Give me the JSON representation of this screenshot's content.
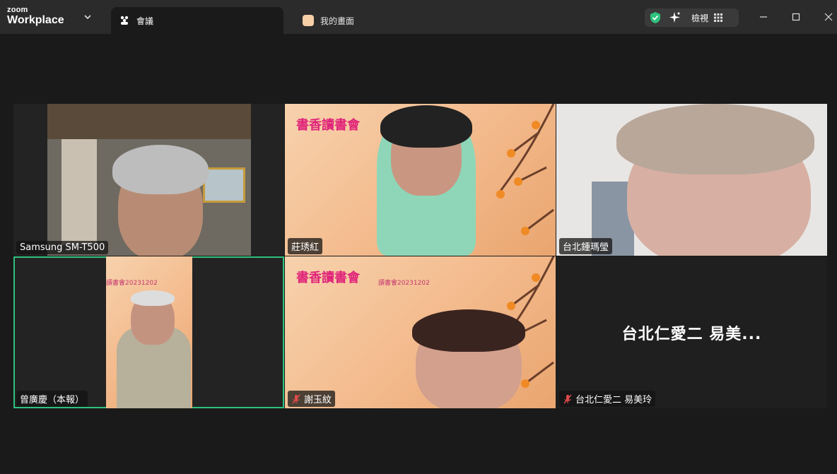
{
  "app": {
    "brand_small": "zoom",
    "brand_large": "Workplace"
  },
  "tabs": [
    {
      "label": "會議",
      "active": true,
      "icon": "meeting-icon"
    },
    {
      "label": "我的畫面",
      "active": false,
      "icon": "self-view-icon"
    }
  ],
  "toolbar": {
    "view_label": "檢視",
    "shield_color": "#2ec27e"
  },
  "participants": [
    {
      "name": "Samsung SM-T500",
      "muted": false,
      "video": true
    },
    {
      "name": "莊琇紅",
      "muted": false,
      "video": true,
      "banner": "書香讀書會"
    },
    {
      "name": "台北鍾瑪瑩",
      "muted": false,
      "video": true
    },
    {
      "name": "曾廣慶（本報）",
      "muted": false,
      "video": true,
      "speaking": true,
      "caption": "讀書會20231202"
    },
    {
      "name": "謝玉紋",
      "muted": true,
      "video": true,
      "banner": "書香讀書會",
      "caption": "讀書會20231202"
    },
    {
      "name": "台北仁愛二 易美玲",
      "muted": true,
      "video": false,
      "display_name": "台北仁愛二 易美..."
    }
  ],
  "colors": {
    "speaking_border": "#2ec27e",
    "mute_red": "#e24a4a",
    "banner_pink": "#e0247a"
  }
}
